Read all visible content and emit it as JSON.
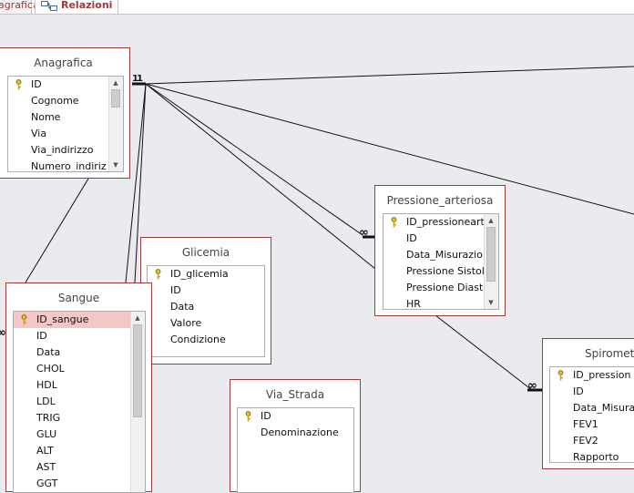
{
  "tabs": [
    {
      "label": "agrafica"
    },
    {
      "label": "Relazioni"
    }
  ],
  "tables": {
    "anagrafica": {
      "title": "Anagrafica",
      "fields": [
        "ID",
        "Cognome",
        "Nome",
        "Via",
        "Via_indirizzo",
        "Numero_indiriz"
      ]
    },
    "glicemia": {
      "title": "Glicemia",
      "fields": [
        "ID_glicemia",
        "ID",
        "Data",
        "Valore",
        "Condizione"
      ]
    },
    "sangue": {
      "title": "Sangue",
      "fields": [
        "ID_sangue",
        "ID",
        "Data",
        "CHOL",
        "HDL",
        "LDL",
        "TRIG",
        "GLU",
        "ALT",
        "AST",
        "GGT"
      ]
    },
    "via_strada": {
      "title": "Via_Strada",
      "fields": [
        "ID",
        "Denominazione"
      ]
    },
    "pressione": {
      "title": "Pressione_arteriosa",
      "fields": [
        "ID_pressioneart",
        "ID",
        "Data_Misurazio",
        "Pressione Sistol",
        "Pressione Diast",
        "HR"
      ]
    },
    "spirometria": {
      "title": "Spirometri",
      "fields": [
        "ID_pression",
        "ID",
        "Data_Misura",
        "FEV1",
        "FEV2",
        "Rapporto"
      ]
    }
  },
  "relationships": {
    "one_label": "1",
    "many_label": "∞"
  },
  "colors": {
    "canvas": "#e9ebef",
    "table_border": "#a23a3a",
    "selected_field": "#f5c6c6",
    "tab_text": "#a4373a"
  }
}
